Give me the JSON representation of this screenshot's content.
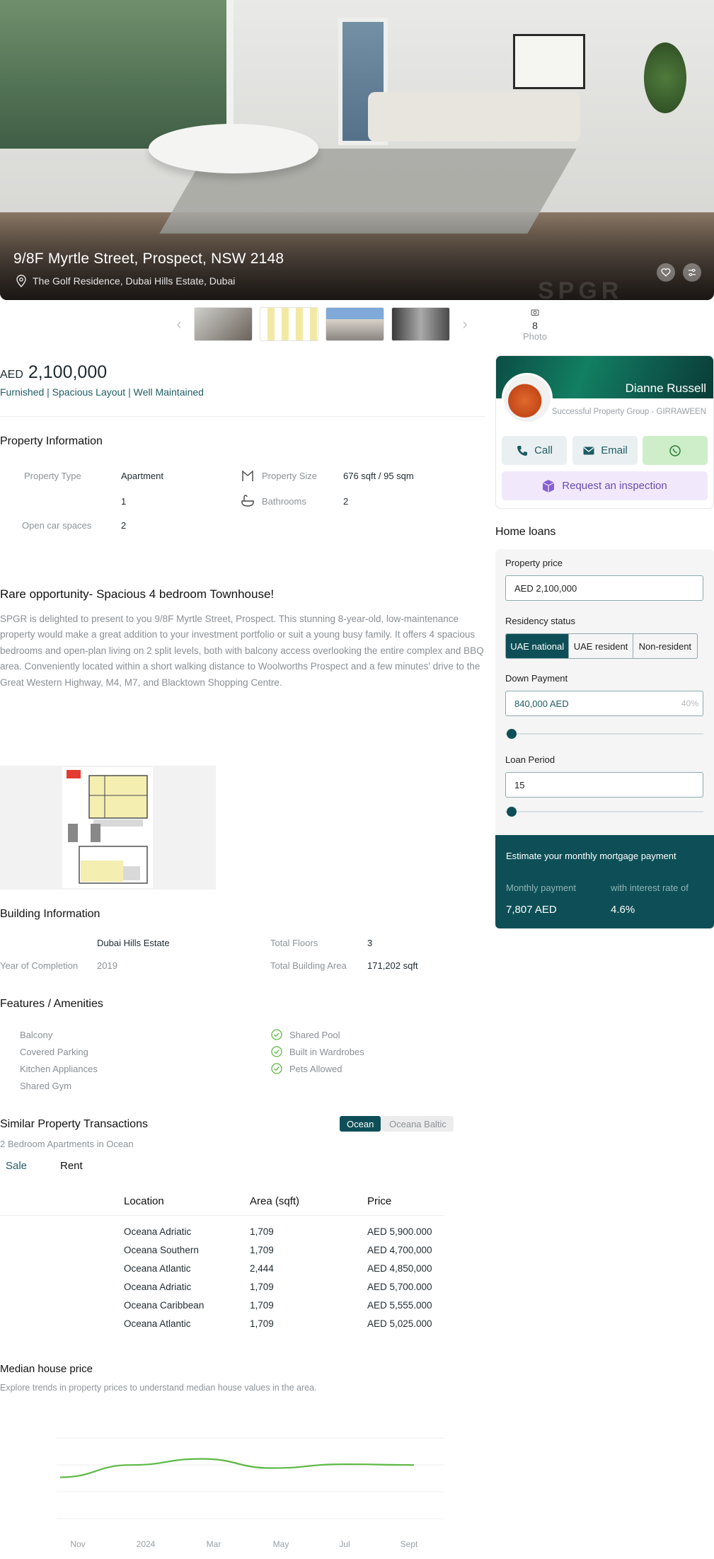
{
  "listing": {
    "title": "9/8F Myrtle Street, Prospect, NSW 2148",
    "address": "The Golf Residence, Dubai Hills Estate, Dubai",
    "watermark": "SPGR",
    "photo_count": "8",
    "photo_label": "Photo",
    "currency": "AED",
    "price": "2,100,000",
    "tags": "Furnished | Spacious Layout | Well Maintained"
  },
  "property_info": {
    "title": "Property Information",
    "type_label": "Property Type",
    "type_value": "Apartment",
    "size_label": "Property Size",
    "size_value": "676 sqft / 95 sqm",
    "bedrooms_value": "1",
    "bathrooms_label": "Bathrooms",
    "bathrooms_value": "2",
    "car_label": "Open car spaces",
    "car_value": "2"
  },
  "description": {
    "title": "Rare opportunity- Spacious 4 bedroom Townhouse!",
    "body": "SPGR is delighted to present to you 9/8F Myrtle Street, Prospect. This stunning 8-year-old, low-maintenance property would make a great addition to your investment portfolio or suit a young busy family. It offers 4 spacious bedrooms and open-plan living on 2 split levels, both with balcony access overlooking the entire complex and BBQ area. Conveniently located within a short walking distance to Woolworths Prospect and a few minutes' drive to the Great Western Highway, M4, M7, and Blacktown Shopping Centre."
  },
  "building": {
    "title": "Building Information",
    "community_value": "Dubai Hills Estate",
    "floors_label": "Total Floors",
    "floors_value": "3",
    "year_label": "Year of Completion",
    "year_value": "2019",
    "area_label": "Total Building Area",
    "area_value": "171,202 sqft"
  },
  "features": {
    "title": "Features / Amenities",
    "left": [
      "Balcony",
      "Covered Parking",
      "Kitchen Appliances",
      "Shared Gym"
    ],
    "right": [
      "Shared Pool",
      "Built in Wardrobes",
      "Pets Allowed"
    ]
  },
  "transactions": {
    "title": "Similar Property Transactions",
    "subtitle": "2 Bedroom Apartments in Ocean",
    "chips": [
      "Ocean",
      "Oceana Baltic"
    ],
    "tabs": [
      "Sale",
      "Rent"
    ],
    "headers": [
      "Location",
      "Area (sqft)",
      "Price"
    ],
    "rows": [
      [
        "Oceana Adriatic",
        "1,709",
        "AED 5,900.000"
      ],
      [
        "Oceana Southern",
        "1,709",
        "AED 4,700,000"
      ],
      [
        "Oceana Atlantic",
        "2,444",
        "AED 4,850,000"
      ],
      [
        "Oceana Adriatic",
        "1,709",
        "AED 5,700.000"
      ],
      [
        "Oceana Caribbean",
        "1,709",
        "AED 5,555.000"
      ],
      [
        "Oceana Atlantic",
        "1,709",
        "AED 5,025.000"
      ]
    ]
  },
  "median": {
    "title": "Median house price",
    "subtitle": "Explore trends in property prices to understand median house values in the area."
  },
  "chart_data": {
    "type": "line",
    "x": [
      "Nov",
      "2024",
      "Mar",
      "May",
      "Jul",
      "Sept"
    ],
    "series": [
      {
        "values": [
          0.62,
          0.78,
          0.86,
          0.74,
          0.79,
          0.78
        ]
      }
    ],
    "line_color": "#5cb843"
  },
  "agent": {
    "name": "Dianne Russell",
    "company": "Successful Property Group - GIRRAWEEN",
    "call_label": "Call",
    "email_label": "Email",
    "inspection_label": "Request an inspection"
  },
  "home_loans": {
    "title": "Home loans",
    "price_label": "Property price",
    "price_value": "AED 2,100,000",
    "residency_label": "Residency status",
    "residency_options": [
      "UAE national",
      "UAE resident",
      "Non-resident"
    ],
    "down_label": "Down Payment",
    "down_value": "840,000 AED",
    "down_percent": "40%",
    "period_label": "Loan Period",
    "period_value": "15",
    "estimate_heading": "Estimate your monthly mortgage payment",
    "monthly_label": "Monthly payment",
    "monthly_value": "7,807 AED",
    "rate_label": "with interest rate of",
    "rate_value": "4.6%"
  },
  "colors": {
    "accent": "#0e4f57",
    "tag_text": "#1e5c63",
    "check": "#5cb843"
  }
}
